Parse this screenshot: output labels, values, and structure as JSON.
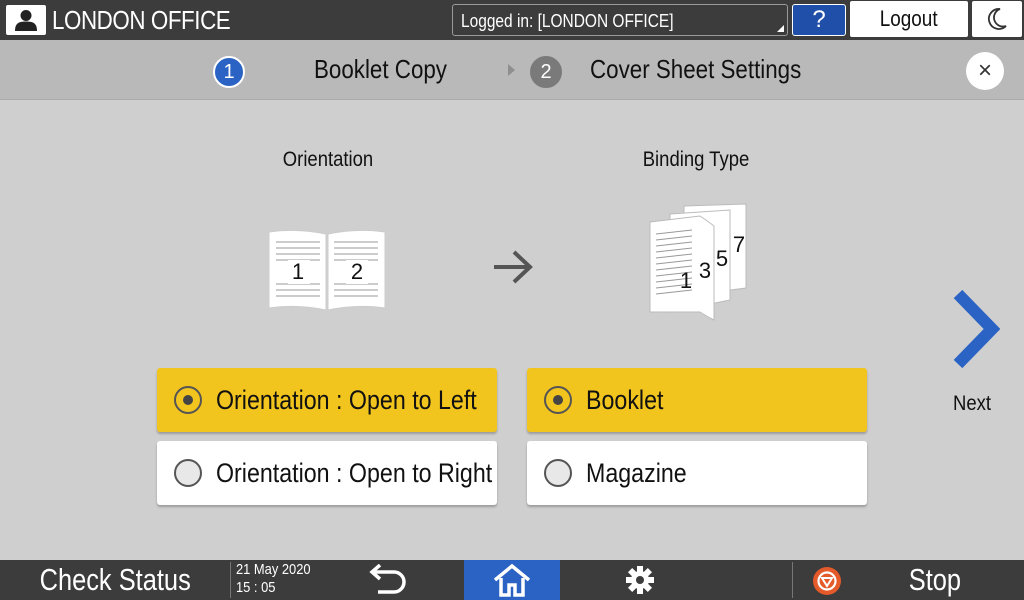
{
  "header": {
    "office_name": "LONDON OFFICE",
    "logged_in_text": "Logged in: [LONDON OFFICE]",
    "help_label": "?",
    "logout_label": "Logout"
  },
  "steps": [
    {
      "number": "1",
      "label": "Booklet Copy"
    },
    {
      "number": "2",
      "label": "Cover Sheet Settings"
    }
  ],
  "close_label": "×",
  "orientation": {
    "title": "Orientation",
    "page_numbers": [
      "1",
      "2"
    ],
    "options": [
      {
        "label": "Orientation : Open to Left",
        "selected": true
      },
      {
        "label": "Orientation : Open to Right",
        "selected": false
      }
    ]
  },
  "binding": {
    "title": "Binding Type",
    "page_numbers": [
      "1",
      "3",
      "5",
      "7"
    ],
    "options": [
      {
        "label": "Booklet",
        "selected": true
      },
      {
        "label": "Magazine",
        "selected": false
      }
    ]
  },
  "next_label": "Next",
  "footer": {
    "check_status_label": "Check Status",
    "date": "21 May 2020",
    "time": "15 : 05",
    "stop_label": "Stop"
  },
  "colors": {
    "selected": "#f2c51e",
    "accent_blue": "#2a63c4",
    "bar_dark": "#3c3c3c",
    "background": "#cfcfcf"
  },
  "icons": [
    "user-icon",
    "moon-icon",
    "close-icon",
    "chevron-right-icon",
    "back-arrow-icon",
    "home-icon",
    "gear-icon",
    "stop-icon"
  ]
}
